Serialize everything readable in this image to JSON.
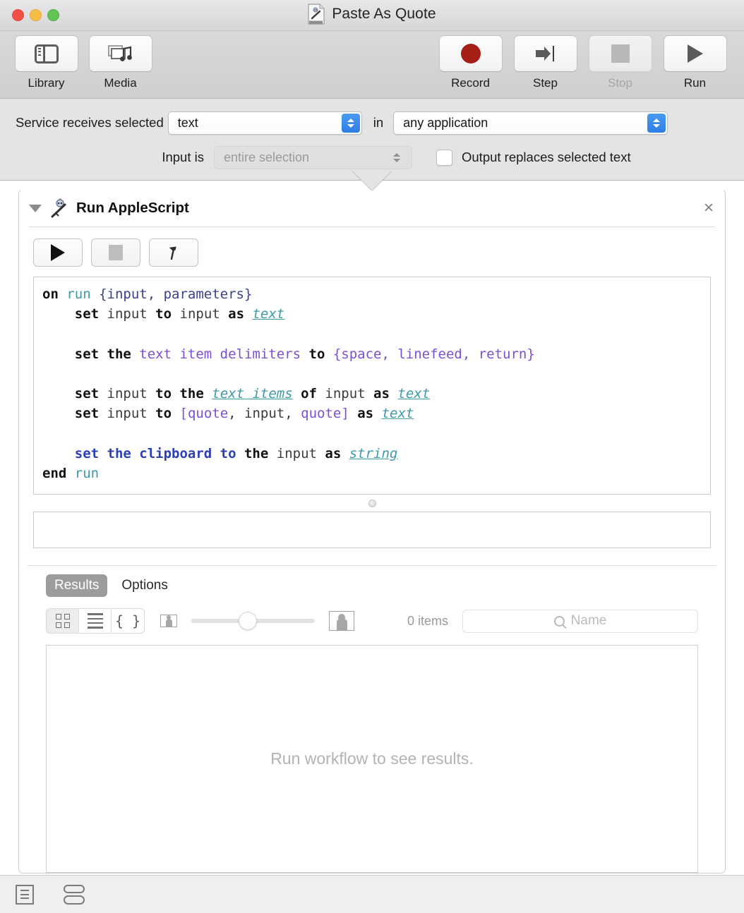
{
  "window": {
    "title": "Paste As Quote",
    "doc_icon": "automator-workflow-document-icon"
  },
  "toolbar": {
    "left_items": [
      {
        "label": "Library",
        "icon": "library-icon",
        "enabled": true
      },
      {
        "label": "Media",
        "icon": "media-icon",
        "enabled": true
      }
    ],
    "right_items": [
      {
        "label": "Record",
        "icon": "record-icon",
        "enabled": true
      },
      {
        "label": "Step",
        "icon": "step-icon",
        "enabled": true
      },
      {
        "label": "Stop",
        "icon": "stop-icon",
        "enabled": false
      },
      {
        "label": "Run",
        "icon": "run-icon",
        "enabled": true
      }
    ]
  },
  "service": {
    "receives_label": "Service receives selected",
    "receives_value": "text",
    "in_word": "in",
    "application_value": "any application",
    "input_is_label": "Input is",
    "input_is_value": "entire selection",
    "input_is_enabled": false,
    "output_replaces_label": "Output replaces selected text",
    "output_replaces_checked": false
  },
  "action": {
    "title": "Run AppleScript",
    "icon": "automator-robot-icon",
    "close_label": "×",
    "expanded": true,
    "script_buttons": [
      {
        "name": "run-script-button",
        "icon": "play-icon",
        "enabled": true
      },
      {
        "name": "stop-script-button",
        "icon": "stop-icon",
        "enabled": false
      },
      {
        "name": "compile-button",
        "icon": "hammer-icon",
        "enabled": true
      }
    ],
    "script_lines": [
      [
        {
          "t": "on ",
          "c": "k-bold"
        },
        {
          "t": "run ",
          "c": "k-teal"
        },
        {
          "t": "{input, parameters}",
          "c": "k-navy"
        }
      ],
      [
        {
          "t": "    "
        },
        {
          "t": "set ",
          "c": "k-bold"
        },
        {
          "t": "input ",
          "c": "k-var"
        },
        {
          "t": "to ",
          "c": "k-bold"
        },
        {
          "t": "input ",
          "c": "k-var"
        },
        {
          "t": "as ",
          "c": "k-bold"
        },
        {
          "t": "text",
          "c": "k-ital"
        }
      ],
      [
        {
          "t": ""
        }
      ],
      [
        {
          "t": "    "
        },
        {
          "t": "set the ",
          "c": "k-bold"
        },
        {
          "t": "text item delimiters ",
          "c": "k-purple"
        },
        {
          "t": "to ",
          "c": "k-bold"
        },
        {
          "t": "{space, linefeed, return}",
          "c": "k-purple"
        }
      ],
      [
        {
          "t": ""
        }
      ],
      [
        {
          "t": "    "
        },
        {
          "t": "set ",
          "c": "k-bold"
        },
        {
          "t": "input ",
          "c": "k-var"
        },
        {
          "t": "to the ",
          "c": "k-bold"
        },
        {
          "t": "text items",
          "c": "k-ital"
        },
        {
          "t": " of ",
          "c": "k-bold"
        },
        {
          "t": "input ",
          "c": "k-var"
        },
        {
          "t": "as ",
          "c": "k-bold"
        },
        {
          "t": "text",
          "c": "k-ital"
        }
      ],
      [
        {
          "t": "    "
        },
        {
          "t": "set ",
          "c": "k-bold"
        },
        {
          "t": "input ",
          "c": "k-var"
        },
        {
          "t": "to ",
          "c": "k-bold"
        },
        {
          "t": "[",
          "c": "k-purple"
        },
        {
          "t": "quote",
          "c": "k-purple"
        },
        {
          "t": ", ",
          "c": "k-var"
        },
        {
          "t": "input",
          "c": "k-var"
        },
        {
          "t": ", ",
          "c": "k-var"
        },
        {
          "t": "quote",
          "c": "k-purple"
        },
        {
          "t": "] ",
          "c": "k-purple"
        },
        {
          "t": "as ",
          "c": "k-bold"
        },
        {
          "t": "text",
          "c": "k-ital"
        }
      ],
      [
        {
          "t": ""
        }
      ],
      [
        {
          "t": "    "
        },
        {
          "t": "set the clipboard to ",
          "c": "k-blue"
        },
        {
          "t": "the ",
          "c": "k-bold"
        },
        {
          "t": "input ",
          "c": "k-var"
        },
        {
          "t": "as ",
          "c": "k-bold"
        },
        {
          "t": "string",
          "c": "k-ital"
        }
      ],
      [
        {
          "t": "end ",
          "c": "k-bold"
        },
        {
          "t": "run",
          "c": "k-teal"
        }
      ]
    ],
    "log_value": "",
    "tabs": [
      {
        "label": "Results",
        "selected": true
      },
      {
        "label": "Options",
        "selected": false
      }
    ],
    "view_modes": [
      {
        "name": "icon-view",
        "icon": "grid-icon",
        "selected": true
      },
      {
        "name": "list-view",
        "icon": "list-icon",
        "selected": false
      },
      {
        "name": "code-view",
        "icon": "braces-icon",
        "selected": false
      }
    ],
    "zoom_slider_value": 45,
    "items_count": "0 items",
    "search_placeholder": "Name",
    "search_value": "",
    "results_message": "Run workflow to see results."
  },
  "bottom_bar": {
    "items": [
      {
        "name": "toggle-log-button",
        "icon": "log-icon"
      },
      {
        "name": "toggle-variables-button",
        "icon": "split-pane-icon"
      }
    ]
  },
  "colors": {
    "accent_blue": "#2e7fe3",
    "record_red": "#a51f16",
    "selected_tab_gray": "#9c9c9c"
  }
}
